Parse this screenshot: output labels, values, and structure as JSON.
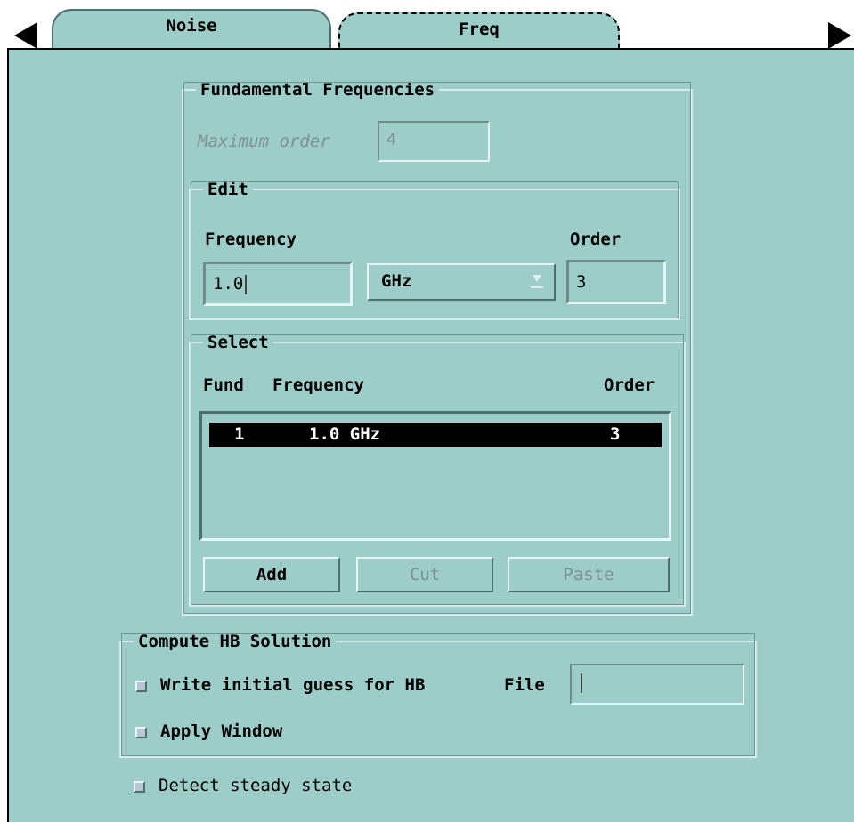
{
  "tabs": [
    {
      "label": "Noise",
      "active": false
    },
    {
      "label": "Freq",
      "active": true
    }
  ],
  "fundamental": {
    "legend": "Fundamental Frequencies",
    "max_order_label": "Maximum order",
    "max_order_value": "4"
  },
  "edit": {
    "legend": "Edit",
    "frequency_label": "Frequency",
    "order_label": "Order",
    "frequency_value": "1.0",
    "unit_value": "GHz",
    "order_value": "3"
  },
  "select": {
    "legend": "Select",
    "headers": {
      "fund": "Fund",
      "frequency": "Frequency",
      "order": "Order"
    },
    "rows": [
      {
        "fund": "1",
        "frequency": "1.0 GHz",
        "order": "3",
        "selected": true
      }
    ],
    "buttons": {
      "add": "Add",
      "cut": "Cut",
      "paste": "Paste"
    }
  },
  "compute": {
    "legend": "Compute HB Solution",
    "write_guess_label": "Write initial guess for HB",
    "file_label": "File",
    "file_value": "",
    "apply_window_label": "Apply Window"
  },
  "detect_steady_label": "Detect steady state",
  "colors": {
    "background": "#9dcdc9",
    "selection": "#000000"
  }
}
